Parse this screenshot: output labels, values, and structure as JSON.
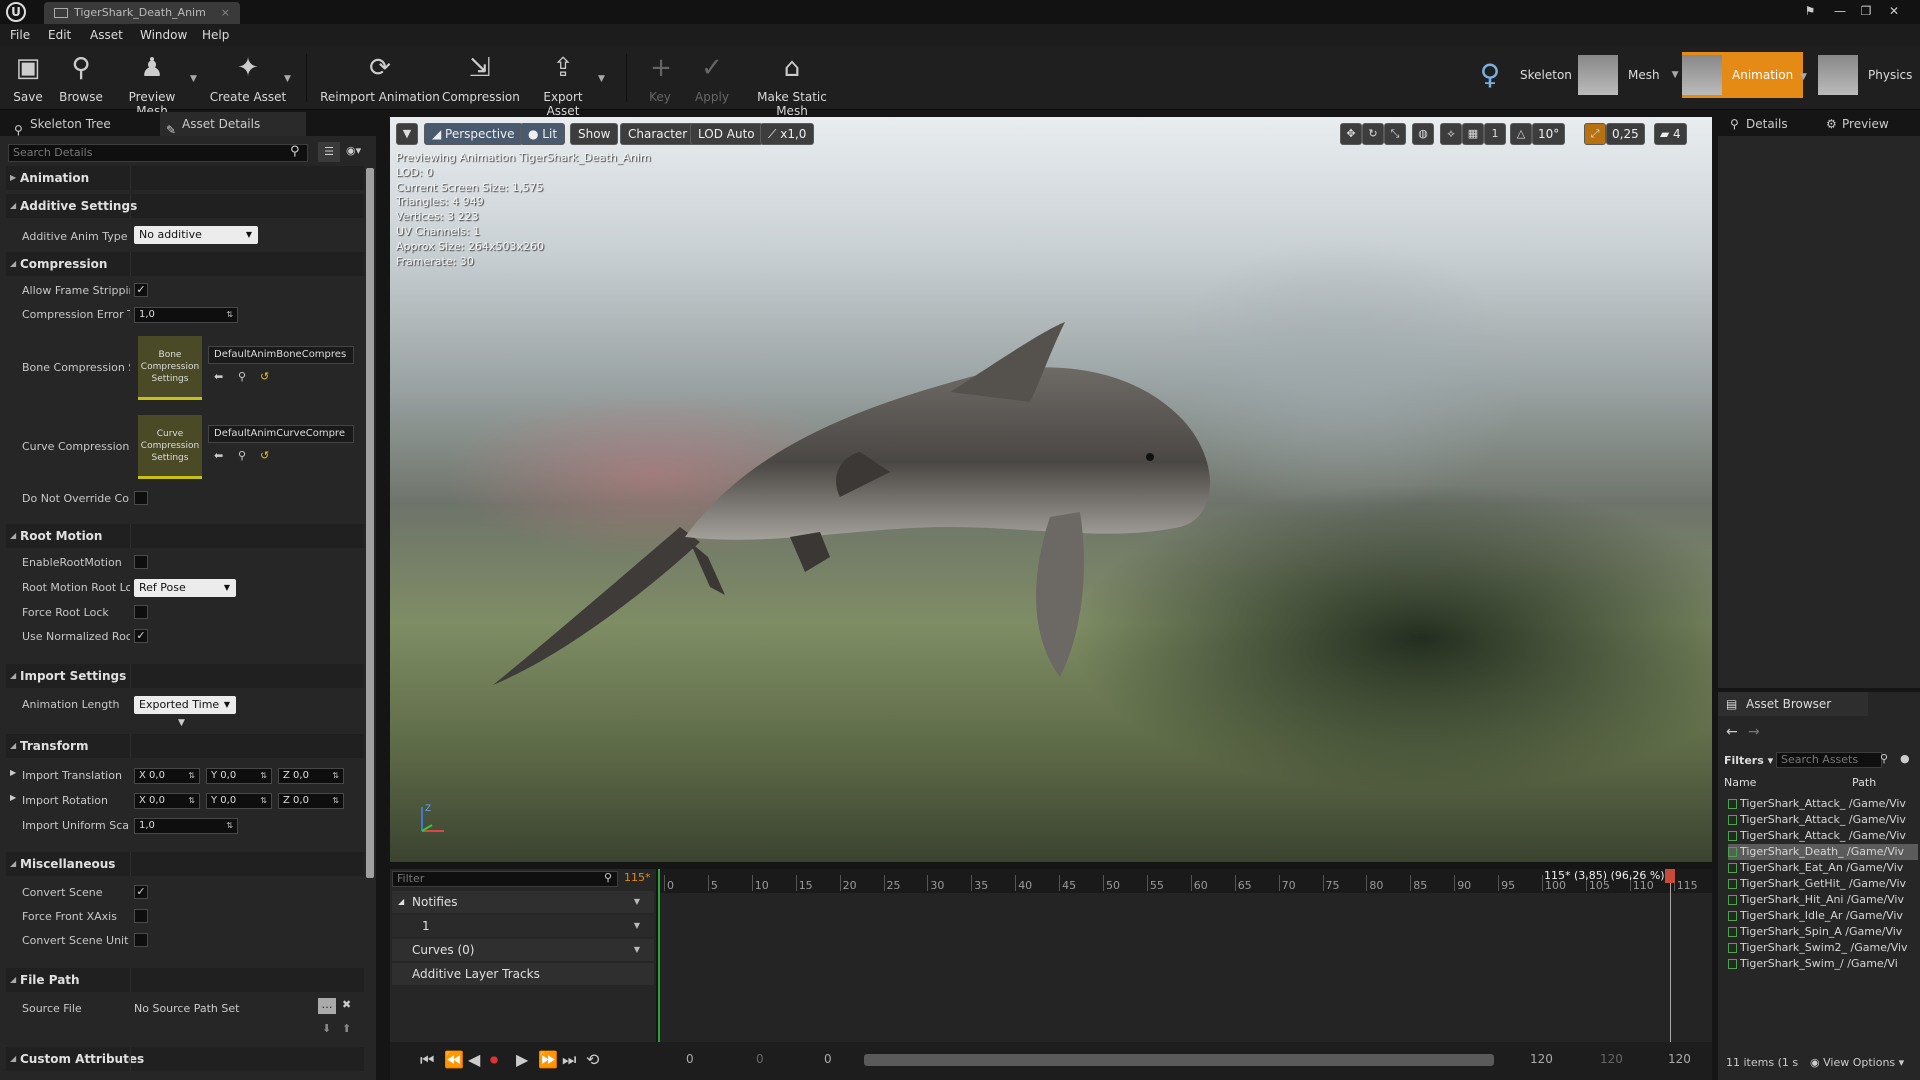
{
  "title_bar": {
    "doc_tab": "TigerShark_Death_Anim"
  },
  "menu": [
    "File",
    "Edit",
    "Asset",
    "Window",
    "Help"
  ],
  "toolbar": {
    "save": "Save",
    "browse": "Browse",
    "preview_mesh": "Preview Mesh",
    "create_asset": "Create Asset",
    "reimport": "Reimport Animation",
    "compression": "Compression",
    "export": "Export Asset",
    "key": "Key",
    "apply": "Apply",
    "make_static": "Make Static Mesh"
  },
  "modes": {
    "skeleton": "Skeleton",
    "mesh": "Mesh",
    "animation": "Animation",
    "physics": "Physics"
  },
  "left_tabs": {
    "skeleton_tree": "Skeleton Tree",
    "asset_details": "Asset Details"
  },
  "details": {
    "search_placeholder": "Search Details",
    "categories": {
      "animation": "Animation",
      "additive": "Additive Settings",
      "compression": "Compression",
      "root_motion": "Root Motion",
      "import_settings": "Import Settings",
      "transform": "Transform",
      "misc": "Miscellaneous",
      "file_path": "File Path",
      "custom_attributes": "Custom Attributes"
    },
    "labels": {
      "additive_type": "Additive Anim Type",
      "allow_frame_stripping": "Allow Frame Stripping",
      "compression_error": "Compression Error Th",
      "bone_compression": "Bone Compression Se",
      "curve_compression": "Curve Compression S",
      "do_not_override": "Do Not Override Comp",
      "enable_root_motion": "EnableRootMotion",
      "root_motion_lock": "Root Motion Root Loc",
      "force_root_lock": "Force Root Lock",
      "use_normalized": "Use Normalized Root",
      "animation_length": "Animation Length",
      "import_translation": "Import Translation",
      "import_rotation": "Import Rotation",
      "import_uniform_scale": "Import Uniform Scale",
      "convert_scene": "Convert Scene",
      "force_front": "Force Front XAxis",
      "convert_scene_unit": "Convert Scene Unit",
      "source_file": "Source File"
    },
    "values": {
      "additive_type": "No additive",
      "compression_error": "1,0",
      "bone_card": "Bone Compression Settings",
      "bone_asset": "DefaultAnimBoneCompres",
      "curve_card": "Curve Compression Settings",
      "curve_asset": "DefaultAnimCurveCompre",
      "root_motion_lock": "Ref Pose",
      "animation_length": "Exported Time",
      "tx": "X 0,0",
      "ty": "Y 0,0",
      "tz": "Z 0,0",
      "rx": "X 0,0",
      "ry": "Y 0,0",
      "rz": "Z 0,0",
      "uniform_scale": "1,0",
      "source_file": "No Source Path Set"
    }
  },
  "viewport": {
    "buttons": {
      "perspective": "Perspective",
      "lit": "Lit",
      "show": "Show",
      "character": "Character",
      "lod": "LOD Auto",
      "speed": "x1,0"
    },
    "snap": {
      "angle": "10°",
      "scale": "0,25",
      "cam_speed": "4"
    },
    "stats": [
      "Previewing Animation TigerShark_Death_Anim",
      "LOD: 0",
      "Current Screen Size: 1,575",
      "Triangles: 4 949",
      "Vertices: 3 223",
      "UV Channels: 1",
      "Approx Size: 264x503x260",
      "Framerate: 30"
    ],
    "axes": {
      "z": "Z",
      "x": "X",
      "y": "Y"
    }
  },
  "timeline": {
    "filter_placeholder": "Filter",
    "current_frame": "115*",
    "notifies": "Notifies",
    "track_1": "1",
    "curves": "Curves  (0)",
    "additive": "Additive Layer Tracks",
    "position_readout": "115* (3,85) (96,26 %)",
    "ticks": [
      "0",
      "5",
      "10",
      "15",
      "20",
      "25",
      "30",
      "35",
      "40",
      "45",
      "50",
      "55",
      "60",
      "65",
      "70",
      "75",
      "80",
      "85",
      "90",
      "95",
      "100",
      "105",
      "110",
      "115"
    ],
    "range": {
      "start_a": "0",
      "start_b": "0",
      "start_c": "0",
      "end_a": "120",
      "end_b": "120",
      "end_c": "120"
    }
  },
  "right_tabs": {
    "details": "Details",
    "preview": "Preview"
  },
  "asset_browser": {
    "tab": "Asset Browser",
    "filters": "Filters",
    "search_placeholder": "Search Assets",
    "col_name": "Name",
    "col_path": "Path",
    "items": [
      "TigerShark_Attack_ /Game/Viv",
      "TigerShark_Attack_ /Game/Viv",
      "TigerShark_Attack_ /Game/Viv",
      "TigerShark_Death_ /Game/Viv",
      "TigerShark_Eat_An /Game/Viv",
      "TigerShark_GetHit_ /Game/Viv",
      "TigerShark_Hit_Ani /Game/Viv",
      "TigerShark_Idle_Ar /Game/Viv",
      "TigerShark_Spin_A /Game/Viv",
      "TigerShark_Swim2_ /Game/Viv",
      "TigerShark_Swim_/ /Game/Vi"
    ],
    "count": "11 items (1 s",
    "view_options": "View Options"
  }
}
